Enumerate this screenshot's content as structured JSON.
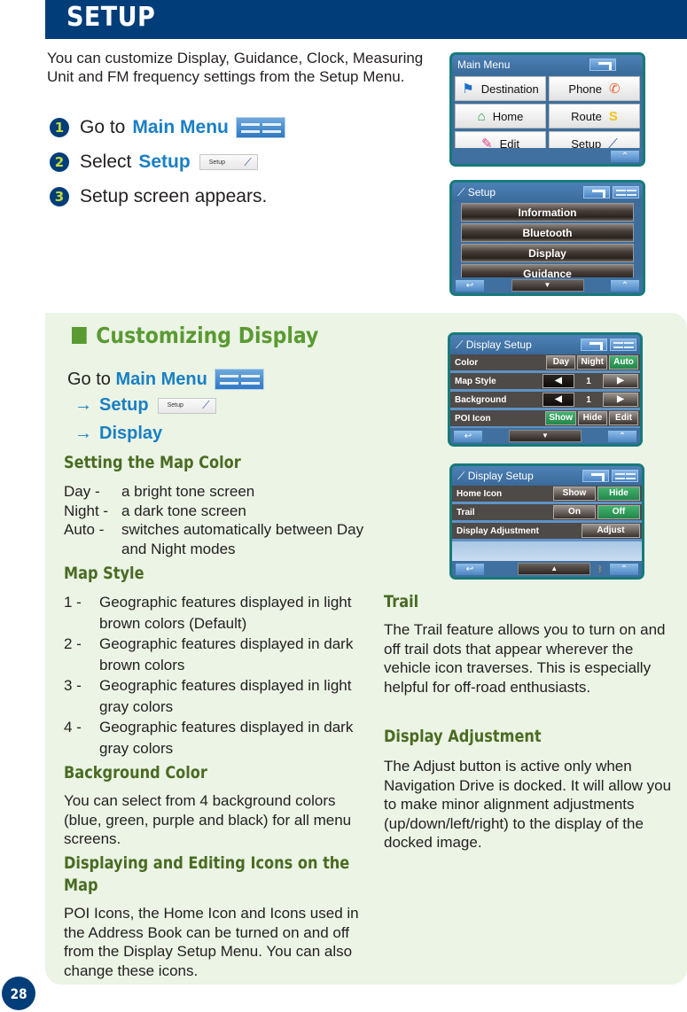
{
  "header": {
    "title": "SETUP"
  },
  "intro": "You can customize Display, Guidance, Clock, Measuring Unit and FM frequency settings from the Setup Menu.",
  "steps": [
    {
      "num": "1",
      "text": "Go to",
      "highlight": "Main Menu",
      "icon": "main-menu-icon"
    },
    {
      "num": "2",
      "text": "Select",
      "highlight": "Setup",
      "icon": "setup-button-thumbnail",
      "chip_label": "Setup"
    },
    {
      "num": "3",
      "text": "Setup screen appears."
    }
  ],
  "main_menu_screen": {
    "title": "Main Menu",
    "items": [
      {
        "label": "Destination",
        "icon": "flag-icon",
        "color": "#1a6fc9"
      },
      {
        "label": "Phone",
        "icon": "phone-icon",
        "color": "#e8622a"
      },
      {
        "label": "Home",
        "icon": "home-icon",
        "color": "#2c9a48"
      },
      {
        "label": "Route",
        "icon": "route-icon",
        "color": "#f2c21b"
      },
      {
        "label": "Edit",
        "icon": "pencil-icon",
        "color": "#e83b86"
      },
      {
        "label": "Setup",
        "icon": "wrench-icon",
        "color": "#2a4aa6"
      }
    ]
  },
  "setup_screen": {
    "title": "Setup",
    "items": [
      "Information",
      "Bluetooth",
      "Display",
      "Guidance"
    ]
  },
  "display_setup_1": {
    "title": "Display Setup",
    "rows": [
      {
        "label": "Color",
        "buttons": [
          {
            "label": "Day",
            "active": false
          },
          {
            "label": "Night",
            "active": false
          },
          {
            "label": "Auto",
            "active": true
          }
        ]
      },
      {
        "label": "Map Style",
        "value": "1"
      },
      {
        "label": "Background",
        "value": "1"
      },
      {
        "label": "POI Icon",
        "buttons": [
          {
            "label": "Show",
            "active": true
          },
          {
            "label": "Hide",
            "active": false
          },
          {
            "label": "Edit",
            "active": false
          }
        ]
      }
    ]
  },
  "display_setup_2": {
    "title": "Display Setup",
    "rows": [
      {
        "label": "Home Icon",
        "buttons": [
          {
            "label": "Show",
            "active": false
          },
          {
            "label": "Hide",
            "active": true
          }
        ]
      },
      {
        "label": "Trail",
        "buttons": [
          {
            "label": "On",
            "active": false
          },
          {
            "label": "Off",
            "active": true
          }
        ]
      },
      {
        "label": "Display Adjustment",
        "buttons": [
          {
            "label": "Adjust",
            "active": false
          }
        ]
      }
    ]
  },
  "customizing": {
    "title": "Customizing Display",
    "nav": {
      "goto": "Go to",
      "main_menu": "Main Menu",
      "arrow": "→",
      "setup": "Setup",
      "display": "Display",
      "chip_label": "Setup"
    },
    "map_color": {
      "heading": "Setting the Map Color",
      "items": [
        {
          "term": "Day -",
          "desc": "a bright tone screen"
        },
        {
          "term": "Night -",
          "desc": "a dark tone screen"
        },
        {
          "term": "Auto -",
          "desc": "switches automatically between Day and Night modes"
        }
      ]
    },
    "map_style": {
      "heading": "Map Style",
      "items": [
        {
          "num": "1 -",
          "desc": "Geographic features displayed in light brown colors (Default)"
        },
        {
          "num": "2 -",
          "desc": "Geographic features displayed in dark brown colors"
        },
        {
          "num": "3 -",
          "desc": "Geographic features displayed in light gray colors"
        },
        {
          "num": "4 -",
          "desc": "Geographic features displayed in dark gray colors"
        }
      ]
    },
    "background_color": {
      "heading": "Background Color",
      "text": "You can select from 4 background colors (blue, green, purple and black) for all menu screens."
    },
    "icons_on_map": {
      "heading_line1": "Displaying and Editing Icons on the",
      "heading_line2": "Map",
      "text": "POI Icons, the Home Icon and Icons used in the Address Book can be turned on and off from the Display Setup Menu. You can also change these icons."
    },
    "trail": {
      "heading": "Trail",
      "text": "The Trail feature allows you to turn on and off trail dots that appear wherever the vehicle icon traverses. This is especially helpful for off-road enthusiasts."
    },
    "display_adjustment": {
      "heading": "Display Adjustment",
      "text": "The Adjust button is active only when Navigation Drive is docked. It will allow you to make minor alignment adjustments (up/down/left/right) to the display of the docked image."
    }
  },
  "page_number": "28",
  "colors": {
    "brand_blue": "#003d79",
    "link_blue": "#1a7fc3",
    "section_green": "#5a9a32",
    "heading_green": "#4a6b22",
    "panel_bg": "#ebf4e5",
    "active_button": "#2f9c58"
  }
}
